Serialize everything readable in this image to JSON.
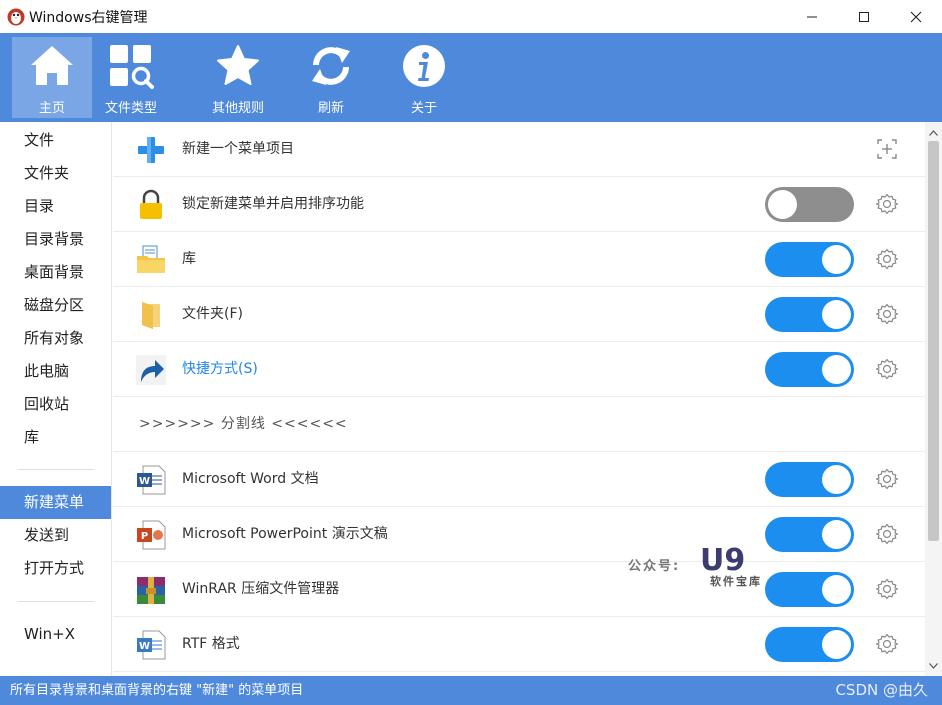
{
  "window": {
    "title": "Windows右键管理"
  },
  "toolbar": {
    "home": "主页",
    "filetypes": "文件类型",
    "rules": "其他规则",
    "refresh": "刷新",
    "about": "关于"
  },
  "sidebar": {
    "items": [
      "文件",
      "文件夹",
      "目录",
      "目录背景",
      "桌面背景",
      "磁盘分区",
      "所有对象",
      "此电脑",
      "回收站",
      "库"
    ],
    "group2": [
      "新建菜单",
      "发送到",
      "打开方式"
    ],
    "group3": [
      "Win+X"
    ],
    "active": "新建菜单"
  },
  "rows": [
    {
      "label": "新建一个菜单项目",
      "icon": "plus-icon",
      "action": "add"
    },
    {
      "label": "锁定新建菜单并启用排序功能",
      "icon": "lock-icon",
      "toggle": false
    },
    {
      "label": "库",
      "icon": "library-folder-icon",
      "toggle": true
    },
    {
      "label": "文件夹(F)",
      "icon": "folder-icon",
      "toggle": true
    },
    {
      "label": "快捷方式(S)",
      "icon": "shortcut-icon",
      "toggle": true
    },
    {
      "label": ">>>>>> 分割线 <<<<<<",
      "icon": "",
      "separator": true
    },
    {
      "label": "Microsoft Word 文档",
      "icon": "word-icon",
      "toggle": true
    },
    {
      "label": "Microsoft PowerPoint 演示文稿",
      "icon": "powerpoint-icon",
      "toggle": true
    },
    {
      "label": "WinRAR 压缩文件管理器",
      "icon": "winrar-icon",
      "toggle": true
    },
    {
      "label": "RTF 格式",
      "icon": "wordpad-icon",
      "toggle": true
    }
  ],
  "status": {
    "text": "所有目录背景和桌面背景的右键 \"新建\" 的菜单项目"
  },
  "watermark": {
    "text": "公众号:",
    "logo": "U9",
    "sub": "软件宝库"
  },
  "credit": "CSDN @由久",
  "colors": {
    "accent": "#4f89dc",
    "toggle_on": "#1c8ef0",
    "toggle_off": "#8e8e8e"
  }
}
